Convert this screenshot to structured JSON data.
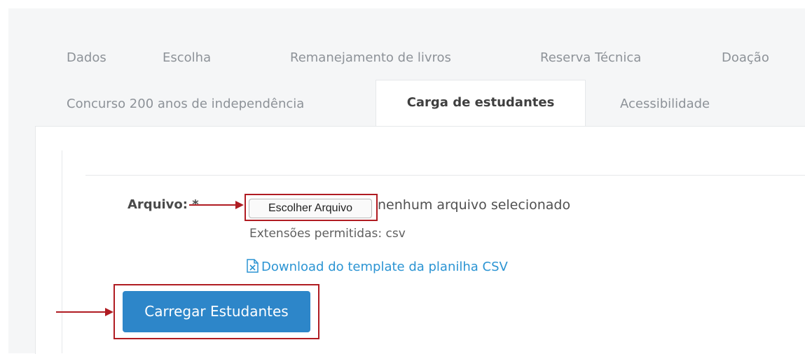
{
  "tabs": [
    {
      "label": "Dados"
    },
    {
      "label": "Escolha"
    },
    {
      "label": "Remanejamento de livros"
    },
    {
      "label": "Reserva Técnica"
    },
    {
      "label": "Doação"
    },
    {
      "label": "Concurso 200 anos de independência"
    },
    {
      "label": "Carga de estudantes",
      "active": true
    },
    {
      "label": "Acessibilidade"
    }
  ],
  "form": {
    "file_label": "Arquivo: *",
    "choose_button": "Escolher Arquivo",
    "no_file_text": "nenhum arquivo selecionado",
    "allowed_extensions": "Extensões permitidas: csv",
    "download_link": "Download do template da planilha CSV",
    "submit_button": "Carregar Estudantes"
  },
  "colors": {
    "accent": "#2d86c9",
    "link": "#2b94d3",
    "annotation": "#b01c22"
  },
  "icons": {
    "download": "excel-file-icon"
  }
}
